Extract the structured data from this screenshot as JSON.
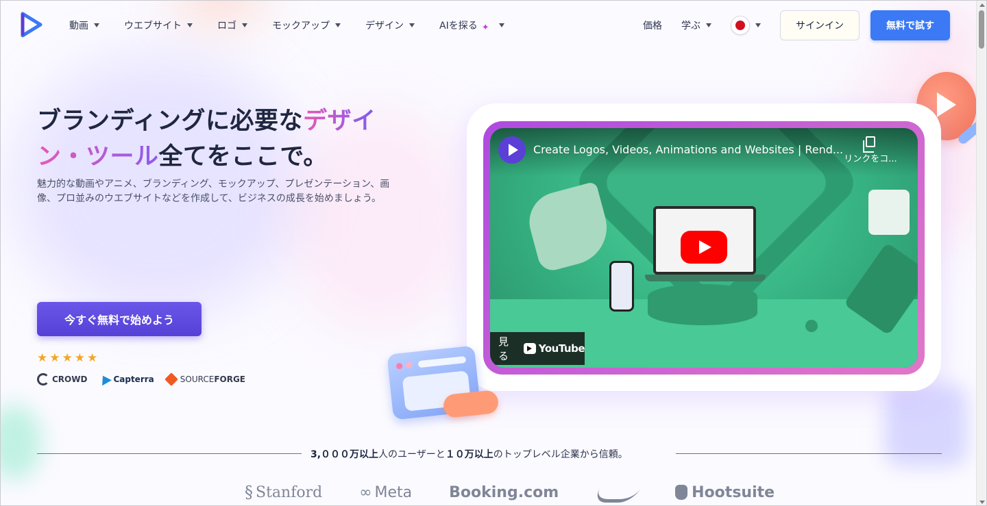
{
  "header": {
    "nav": [
      {
        "label": "動画"
      },
      {
        "label": "ウエブサイト"
      },
      {
        "label": "ロゴ"
      },
      {
        "label": "モックアップ"
      },
      {
        "label": "デザイン"
      },
      {
        "label": "AIを探る"
      }
    ],
    "pricing": "価格",
    "learn": "学ぶ",
    "signin": "サインイン",
    "trial": "無料で試す",
    "accent": "#3b79f5"
  },
  "hero": {
    "title_part1": "ブランディングに必要な",
    "title_part2": "デザイ",
    "title_part3": "ン・ツール",
    "title_part4": "全てをここで。",
    "description": "魅力的な動画やアニメ、ブランディング、モックアップ、プレゼンテーション、画像、プロ並みのウエブサイトなどを作成して、ビジネスの成長を始めましょう。",
    "cta": "今すぐ無料で始めよう",
    "stars": [
      "★",
      "★",
      "★",
      "★",
      "★"
    ],
    "badges": {
      "g2": "CROWD",
      "capterra": "Capterra",
      "sourceforge_a": "SOURCE",
      "sourceforge_b": "FORGE"
    }
  },
  "video": {
    "title": "Create Logos, Videos, Animations and Websites | Rend...",
    "copy_link": "リンクをコ...",
    "watch": "見る",
    "youtube": "YouTube"
  },
  "trust": {
    "users_num": "3,０００万以上",
    "text1": "人のユーザーと",
    "companies_num": "１０万以上",
    "text2": "のトップレベル企業から信頼。"
  },
  "logos": {
    "stanford": "Stanford",
    "meta": "Meta",
    "booking": "Booking.com",
    "hootsuite": "Hootsuite"
  }
}
